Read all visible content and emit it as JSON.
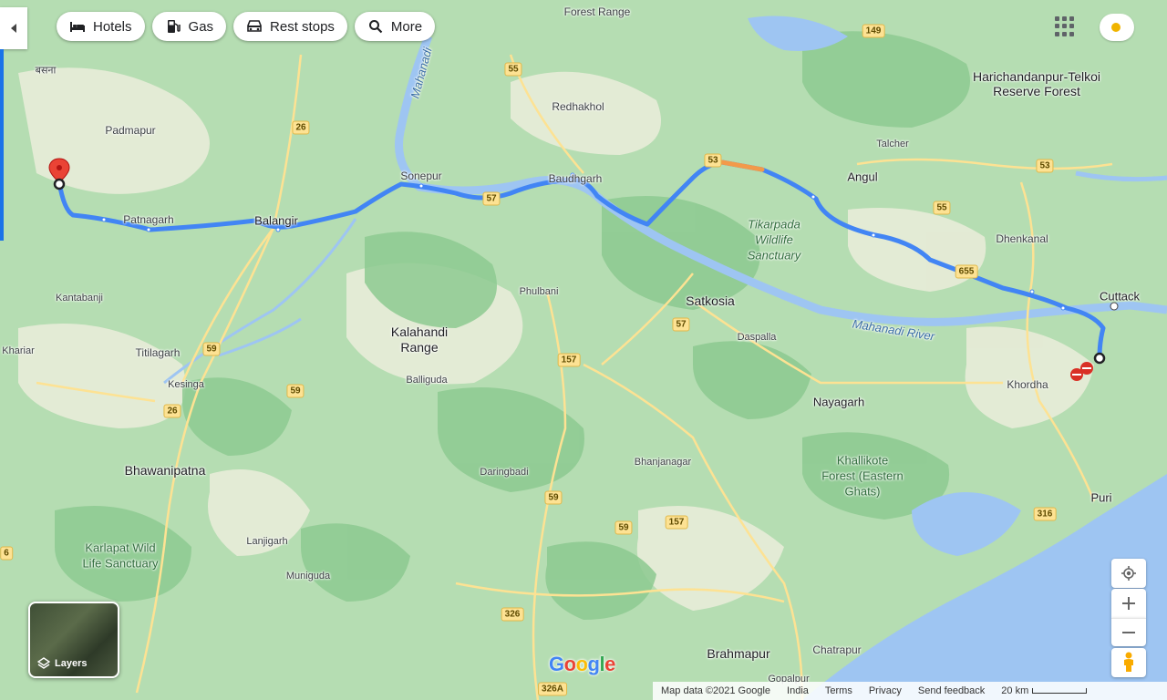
{
  "chips": [
    {
      "label": "Hotels",
      "icon": "bed-icon"
    },
    {
      "label": "Gas",
      "icon": "gas-pump-icon"
    },
    {
      "label": "Rest stops",
      "icon": "restroom-icon"
    },
    {
      "label": "More",
      "icon": "search-icon"
    }
  ],
  "labels": {
    "forest_range": "Forest Range",
    "basna": "बसना",
    "padmapur": "Padmapur",
    "mahanadi_n": "Mahanadi",
    "redhakhol": "Redhakhol",
    "harichandanpur": "Harichandanpur-Telkoi",
    "reserve_forest": "Reserve Forest",
    "talcher": "Talcher",
    "sonepur": "Sonepur",
    "baudhgarh": "Baudhgarh",
    "angul": "Angul",
    "patnagarh": "Patnagarh",
    "balangir": "Balangir",
    "tikarpada1": "Tikarpada",
    "tikarpada2": "Wildlife",
    "tikarpada3": "Sanctuary",
    "dhenkanal": "Dhenkanal",
    "kantabanji": "Kantabanji",
    "phulbani": "Phulbani",
    "satkosia": "Satkosia",
    "cuttack": "Cuttack",
    "kalahandi1": "Kalahandi",
    "kalahandi2": "Range",
    "mahanadi_river": "Mahanadi River",
    "khariar": "Khariar",
    "titilagarh": "Titilagarh",
    "daspalla": "Daspalla",
    "kesinga": "Kesinga",
    "balliguda": "Balliguda",
    "khordha": "Khordha",
    "nayagarh": "Nayagarh",
    "bhawanipatna": "Bhawanipatna",
    "daringbadi": "Daringbadi",
    "bhanjanagar": "Bhanjanagar",
    "khallikote1": "Khallikote",
    "khallikote2": "Forest (Eastern",
    "khallikote3": "Ghats)",
    "puri": "Puri",
    "karlapat1": "Karlapat Wild",
    "karlapat2": "Life Sanctuary",
    "lanjigarh": "Lanjigarh",
    "muniguda": "Muniguda",
    "brahmapur": "Brahmapur",
    "chatrapur": "Chatrapur",
    "gopalpur": "Gopalpur"
  },
  "shields": {
    "s149": "149",
    "s55a": "55",
    "s26a": "26",
    "s53": "53",
    "s55b": "55",
    "s53b": "53",
    "s57a": "57",
    "s655": "655",
    "s57b": "57",
    "s59a": "59",
    "s157a": "157",
    "s59b": "59",
    "s26b": "26",
    "s59c": "59",
    "s157b": "157",
    "s59d": "59",
    "s316": "316",
    "s326": "326",
    "s326a": "326A",
    "s6": "6"
  },
  "layers_label": "Layers",
  "google_logo": "Google",
  "footer": {
    "map_data": "Map data ©2021 Google",
    "country": "India",
    "terms": "Terms",
    "privacy": "Privacy",
    "feedback": "Send feedback",
    "scale": "20 km"
  },
  "colors": {
    "route": "#4285f4",
    "route_slow": "#f29a4a",
    "water": "#9fc6f4",
    "land": "#b2dcb0",
    "forest": "#8cc98e",
    "road": "#fde293",
    "pin": "#ea4335"
  }
}
